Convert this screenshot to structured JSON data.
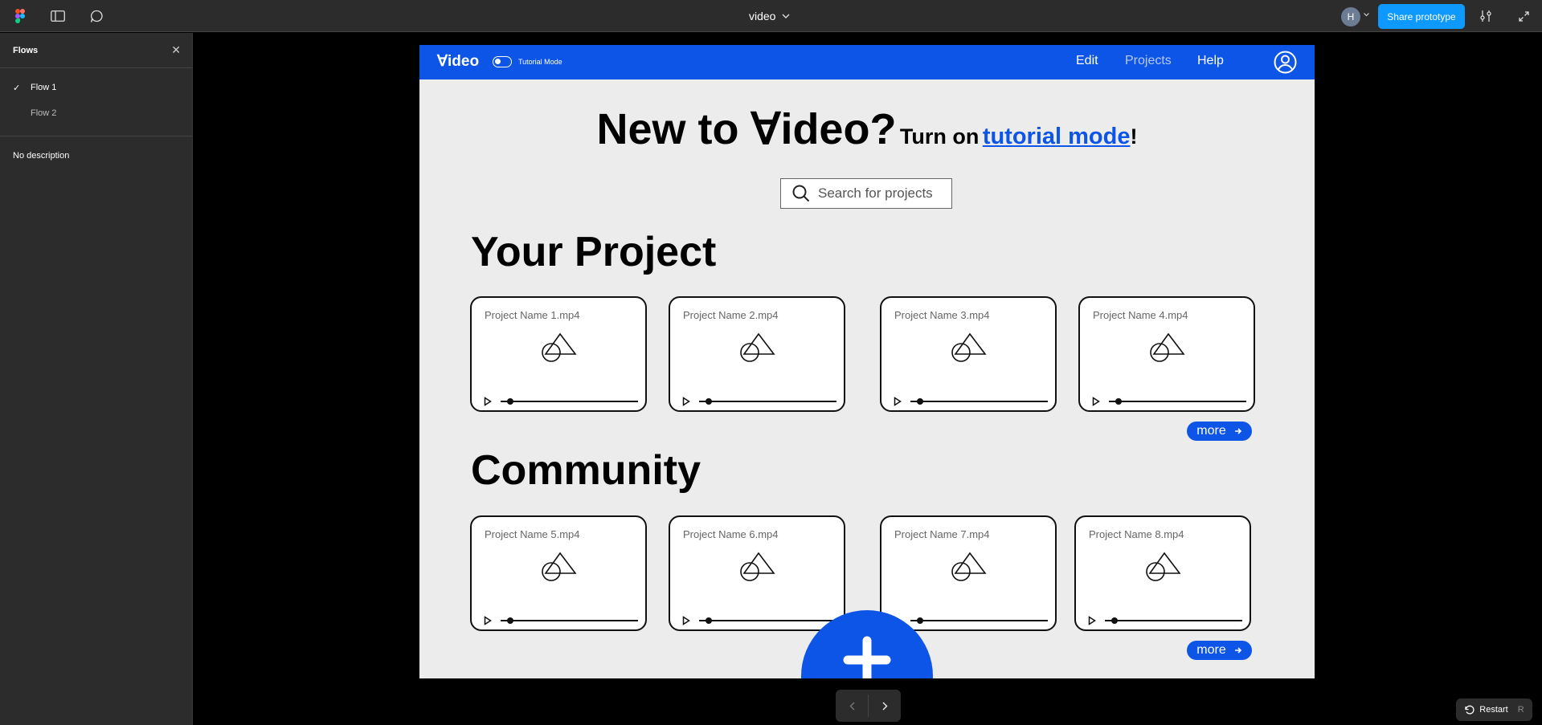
{
  "toolbar": {
    "document_title": "video",
    "avatar_initial": "H",
    "share_label": "Share prototype"
  },
  "flows_panel": {
    "title": "Flows",
    "flows": [
      {
        "label": "Flow 1",
        "selected": true
      },
      {
        "label": "Flow 2",
        "selected": false
      }
    ],
    "description": "No description"
  },
  "app": {
    "brand": "∀ideo",
    "tutorial_toggle_label": "Tutorial Mode",
    "nav": {
      "edit": "Edit",
      "projects": "Projects",
      "help": "Help"
    },
    "hero": {
      "headline": "New to ∀ideo?",
      "prefix": "Turn on",
      "link": "tutorial mode",
      "suffix": "!"
    },
    "search_placeholder": "Search for projects",
    "your_projects": {
      "title": "Your Project",
      "cards": [
        "Project Name 1.mp4",
        "Project Name 2.mp4",
        "Project Name 3.mp4",
        "Project Name 4.mp4"
      ],
      "more_label": "more"
    },
    "community": {
      "title": "Community",
      "cards": [
        "Project Name 5.mp4",
        "Project Name 6.mp4",
        "Project Name 7.mp4",
        "Project Name 8.mp4"
      ],
      "more_label": "more"
    }
  },
  "footer": {
    "restart_label": "Restart",
    "restart_key": "R"
  },
  "colors": {
    "app_blue": "#0d55e6",
    "share_blue": "#0d99ff",
    "chrome": "#2c2c2c"
  }
}
